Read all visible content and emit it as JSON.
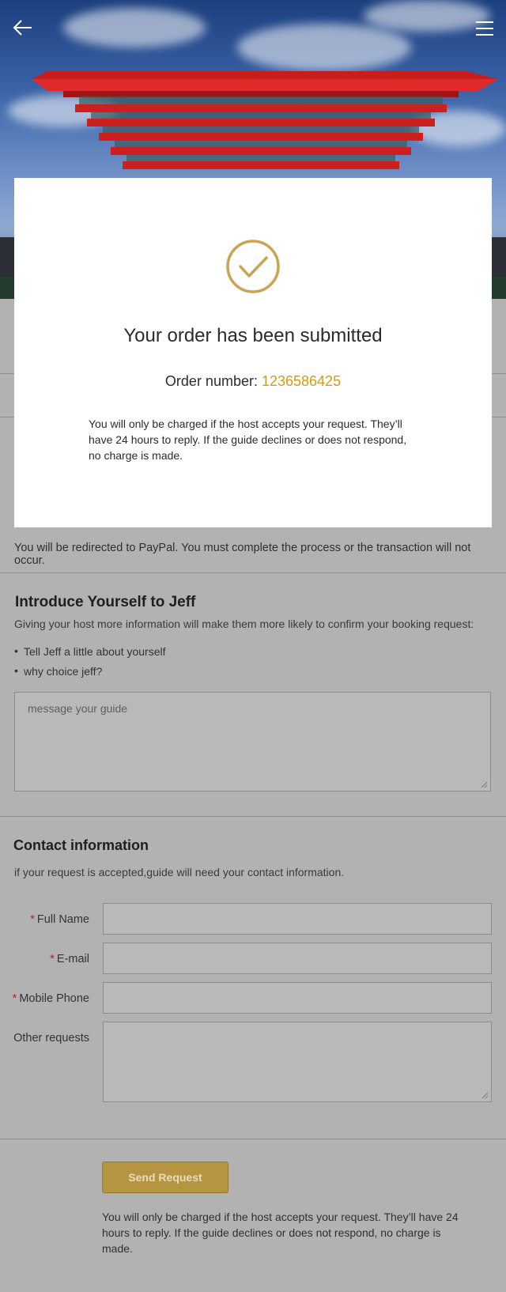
{
  "header": {
    "back_icon": "arrow-left-icon",
    "menu_icon": "hamburger-menu-icon"
  },
  "paypal_notice": "You will be redirected to PayPal. You must complete the process or the transaction will not occur.",
  "introduce": {
    "title": "Introduce Yourself to Jeff",
    "subtitle": "Giving your host more information will make them more likely to confirm your booking request:",
    "bullets": [
      "Tell Jeff a little about yourself",
      "why choice jeff?"
    ],
    "message_placeholder": "message your guide"
  },
  "contact": {
    "title": "Contact information",
    "subtitle": "if your request is accepted,guide will need your contact information.",
    "required_mark": "*",
    "fields": [
      {
        "label": "Full Name",
        "required": true,
        "value": ""
      },
      {
        "label": "E-mail",
        "required": true,
        "value": ""
      },
      {
        "label": "Mobile Phone",
        "required": true,
        "value": ""
      },
      {
        "label": "Other requests",
        "required": false,
        "value": ""
      }
    ]
  },
  "submit": {
    "button_label": "Send Request",
    "note": "You will only be charged if the host accepts your request. They’ll have 24 hours to reply. If the guide declines or does not respond, no charge is made."
  },
  "modal": {
    "icon": "check-circle-icon",
    "title": "Your order has been submitted",
    "order_label": "Order number: ",
    "order_number": "1236586425",
    "body": "You will only be charged if the host accepts your request. They’ll have 24 hours to reply. If the guide declines or does not respond, no charge is made."
  },
  "colors": {
    "accent": "#d69a17",
    "button": "#b59542",
    "overlay": "#b2b2b2",
    "required": "#c21a1a"
  }
}
